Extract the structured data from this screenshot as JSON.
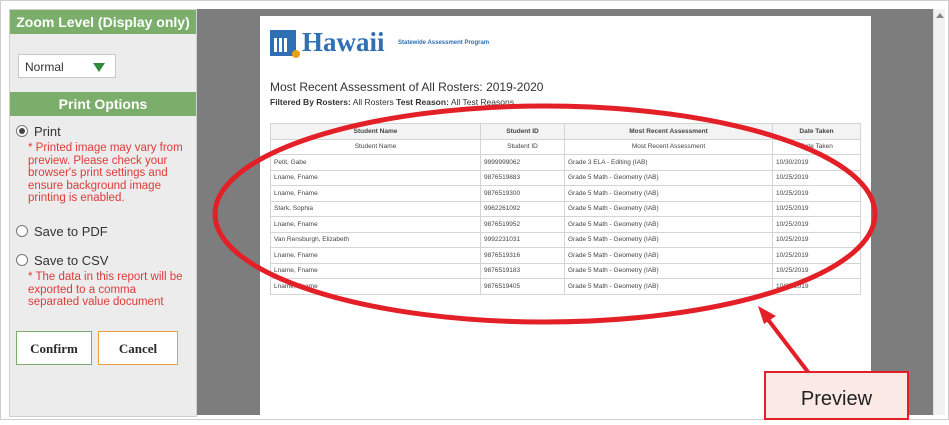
{
  "sidebar": {
    "zoom_header": "Zoom Level (Display only)",
    "zoom_value": "Normal",
    "print_header": "Print Options",
    "options": [
      {
        "label": "Print",
        "selected": true,
        "note": "* Printed image may vary from preview. Please check your browser's print settings and ensure background image printing is enabled."
      },
      {
        "label": "Save to PDF",
        "selected": false,
        "note": ""
      },
      {
        "label": "Save to CSV",
        "selected": false,
        "note": "* The data in this report will be exported to a comma separated value document"
      }
    ],
    "confirm_label": "Confirm",
    "cancel_label": "Cancel"
  },
  "report": {
    "logo_text": "Hawaii",
    "logo_sub": "Statewide Assessment Program",
    "title": "Most Recent Assessment of All Rosters: 2019-2020",
    "filter_label": "Filtered By Rosters:",
    "filter_value": "All Rosters",
    "filter_label2": "Test Reason:",
    "filter_value2": "All Test Reasons",
    "columns": [
      "Student Name",
      "Student ID",
      "Most Recent Assessment",
      "Date Taken"
    ],
    "sub_columns": [
      "Student Name",
      "Student ID",
      "Most Recent Assessment",
      "Date Taken"
    ],
    "rows": [
      [
        "Petit, Gabe",
        "9999999062",
        "Grade 3 ELA - Editing (IAB)",
        "10/30/2019"
      ],
      [
        "Lname, Fname",
        "9876519883",
        "Grade 5 Math - Geometry (IAB)",
        "10/25/2019"
      ],
      [
        "Lname, Fname",
        "9876519300",
        "Grade 5 Math - Geometry (IAB)",
        "10/25/2019"
      ],
      [
        "Stark, Sophia",
        "9962261092",
        "Grade 5 Math - Geometry (IAB)",
        "10/25/2019"
      ],
      [
        "Lname, Fname",
        "9876519952",
        "Grade 5 Math - Geometry (IAB)",
        "10/25/2019"
      ],
      [
        "Van Rensburgh, Elizabeth",
        "9992231031",
        "Grade 5 Math - Geometry (IAB)",
        "10/25/2019"
      ],
      [
        "Lname, Fname",
        "9876519316",
        "Grade 5 Math - Geometry (IAB)",
        "10/25/2019"
      ],
      [
        "Lname, Fname",
        "9876519183",
        "Grade 5 Math - Geometry (IAB)",
        "10/25/2019"
      ],
      [
        "Lname, Fname",
        "9876519405",
        "Grade 5 Math - Geometry (IAB)",
        "10/25/2019"
      ]
    ]
  },
  "callout": {
    "label": "Preview"
  },
  "colors": {
    "accent_green": "#7cae6b",
    "note_red": "#e03a3a",
    "annotation_red": "#e32027",
    "logo_blue": "#2f6fb3"
  }
}
